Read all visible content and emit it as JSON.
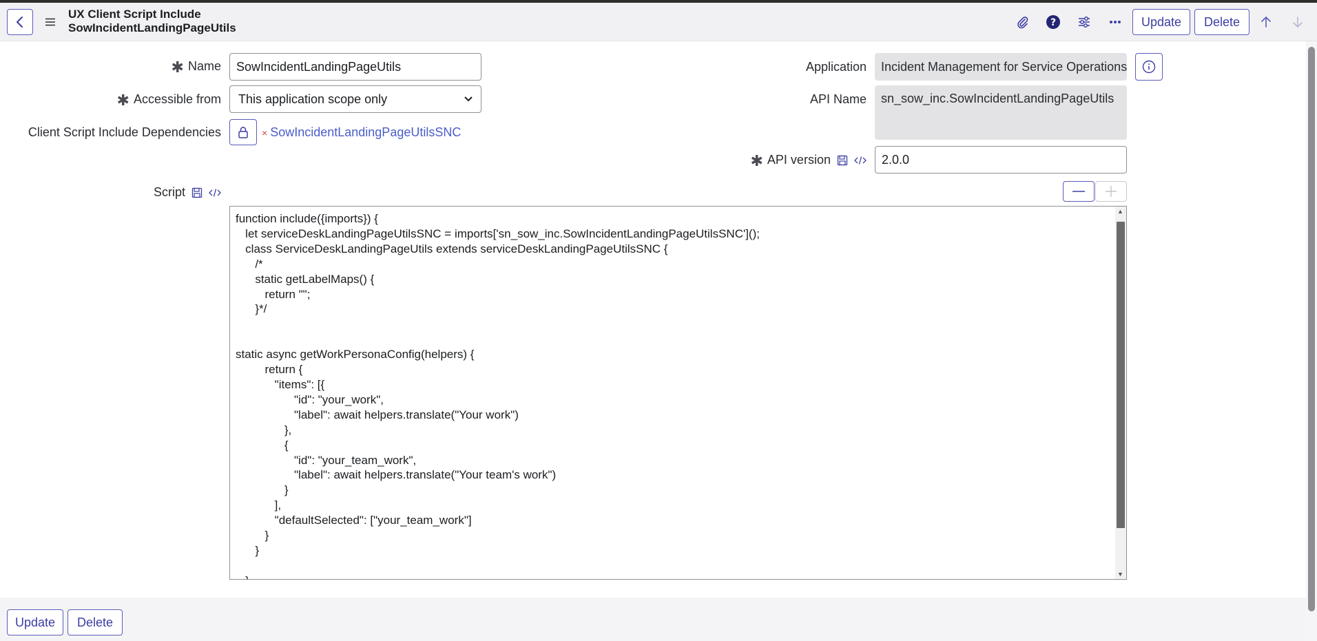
{
  "header": {
    "title_line1": "UX Client Script Include",
    "title_line2": "SowIncidentLandingPageUtils",
    "update_label": "Update",
    "delete_label": "Delete"
  },
  "form": {
    "name_label": "Name",
    "name_value": "SowIncidentLandingPageUtils",
    "accessible_label": "Accessible from",
    "accessible_value": "This application scope only",
    "dependencies_label": "Client Script Include Dependencies",
    "dependency_item": "SowIncidentLandingPageUtilsSNC",
    "dependency_remove": "×",
    "application_label": "Application",
    "application_value": "Incident Management for Service Operations W",
    "api_name_label": "API Name",
    "api_name_value": "sn_sow_inc.SowIncidentLandingPageUtils",
    "api_version_label": "API version",
    "api_version_value": "2.0.0",
    "script_label": "Script"
  },
  "script_code": "function include({imports}) {\n   let serviceDeskLandingPageUtilsSNC = imports['sn_sow_inc.SowIncidentLandingPageUtilsSNC']();\n   class ServiceDeskLandingPageUtils extends serviceDeskLandingPageUtilsSNC {\n      /*\n      static getLabelMaps() {\n         return \"\";\n      }*/\n\n\nstatic async getWorkPersonaConfig(helpers) {\n         return {\n            \"items\": [{\n                  \"id\": \"your_work\",\n                  \"label\": await helpers.translate(\"Your work\")\n               },\n               {\n                  \"id\": \"your_team_work\",\n                  \"label\": await helpers.translate(\"Your team's work\")\n               }\n            ],\n            \"defaultSelected\": [\"your_team_work\"]\n         }\n      }\n\n   }",
  "footer": {
    "update_label": "Update",
    "delete_label": "Delete"
  },
  "colors": {
    "accent": "#3c3ea3",
    "header_bg": "#f1f1f4",
    "readonly_bg": "#e3e3e6"
  }
}
